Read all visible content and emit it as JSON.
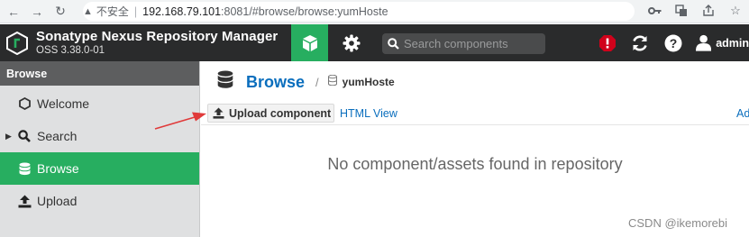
{
  "browser": {
    "insecure_label": "不安全",
    "url_host": "192.168.79.101",
    "url_rest": ":8081/#browse/browse:yumHoste"
  },
  "header": {
    "title": "Sonatype Nexus Repository Manager",
    "version": "OSS 3.38.0-01",
    "search_placeholder": "Search components",
    "user": "admin",
    "accent_color": "#27ae60",
    "alert_color": "#d0021b"
  },
  "sidebar": {
    "heading": "Browse",
    "items": [
      {
        "label": "Welcome",
        "icon": "hexagon-icon"
      },
      {
        "label": "Search",
        "icon": "search-icon"
      },
      {
        "label": "Browse",
        "icon": "database-icon"
      },
      {
        "label": "Upload",
        "icon": "upload-icon"
      }
    ]
  },
  "main": {
    "breadcrumb_title": "Browse",
    "breadcrumb_separator": "/",
    "repository": "yumHoste",
    "upload_button": "Upload component",
    "html_view": "HTML View",
    "advanced_link": "Ad",
    "empty_message": "No component/assets found in repository"
  },
  "watermark": "CSDN @ikemorebi"
}
